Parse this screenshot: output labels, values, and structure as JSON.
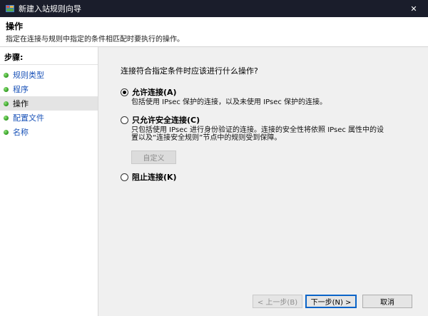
{
  "window": {
    "title": "新建入站规则向导",
    "close_glyph": "✕"
  },
  "header": {
    "title": "操作",
    "subtitle": "指定在连接与规则中指定的条件相匹配时要执行的操作。"
  },
  "steps": {
    "label": "步骤:",
    "items": [
      {
        "label": "规则类型"
      },
      {
        "label": "程序"
      },
      {
        "label": "操作"
      },
      {
        "label": "配置文件"
      },
      {
        "label": "名称"
      }
    ],
    "current_index": 2
  },
  "main": {
    "question": "连接符合指定条件时应该进行什么操作?",
    "options": [
      {
        "label": "允许连接(A)",
        "description": "包括使用 IPsec 保护的连接，以及未使用 IPsec 保护的连接。",
        "selected": true
      },
      {
        "label": "只允许安全连接(C)",
        "description_line1": "只包括使用 IPsec 进行身份验证的连接。连接的安全性将依照 IPsec 属性中的设",
        "description_line2": "置以及“连接安全规则”节点中的规则受到保障。",
        "selected": false
      },
      {
        "label": "阻止连接(K)",
        "selected": false
      }
    ],
    "customize_label": "自定义"
  },
  "buttons": {
    "back": "< 上一步(B)",
    "next": "下一步(N) >",
    "cancel": "取消"
  }
}
